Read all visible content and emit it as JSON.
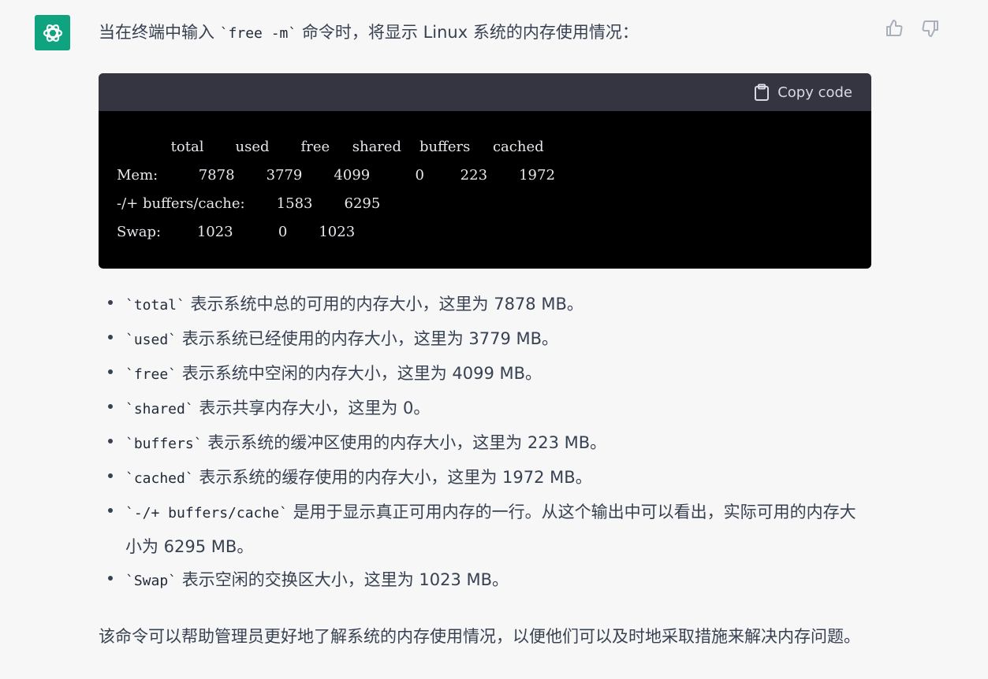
{
  "intro": {
    "before": "当在终端中输入 ",
    "code": "`free -m`",
    "after": " 命令时，将显示 Linux 系统的内存使用情况："
  },
  "code_block": {
    "copy_label": "Copy code",
    "lines": [
      "            total       used       free     shared    buffers     cached",
      "Mem:         7878       3779       4099          0        223       1972",
      "-/+ buffers/cache:       1583       6295",
      "Swap:        1023          0       1023"
    ]
  },
  "bullets": [
    {
      "code": "`total`",
      "text": " 表示系统中总的可用的内存大小，这里为 7878 MB。"
    },
    {
      "code": "`used`",
      "text": " 表示系统已经使用的内存大小，这里为 3779 MB。"
    },
    {
      "code": "`free`",
      "text": " 表示系统中空闲的内存大小，这里为 4099 MB。"
    },
    {
      "code": "`shared`",
      "text": " 表示共享内存大小，这里为 0。"
    },
    {
      "code": "`buffers`",
      "text": " 表示系统的缓冲区使用的内存大小，这里为 223 MB。"
    },
    {
      "code": "`cached`",
      "text": " 表示系统的缓存使用的内存大小，这里为 1972 MB。"
    },
    {
      "code": "`-/+ buffers/cache`",
      "text": " 是用于显示真正可用内存的一行。从这个输出中可以看出，实际可用的内存大小为 6295 MB。"
    },
    {
      "code": "`Swap`",
      "text": " 表示空闲的交换区大小，这里为 1023 MB。"
    }
  ],
  "summary": "该命令可以帮助管理员更好地了解系统的内存使用情况，以便他们可以及时地采取措施来解决内存问题。",
  "icons": [
    "openai-logo-icon",
    "thumbs-up-icon",
    "thumbs-down-icon",
    "clipboard-icon"
  ],
  "colors": {
    "avatar_bg": "#10a37f",
    "code_header_bg": "#343541",
    "code_bg": "#000000",
    "page_bg": "#f7f7f8"
  }
}
